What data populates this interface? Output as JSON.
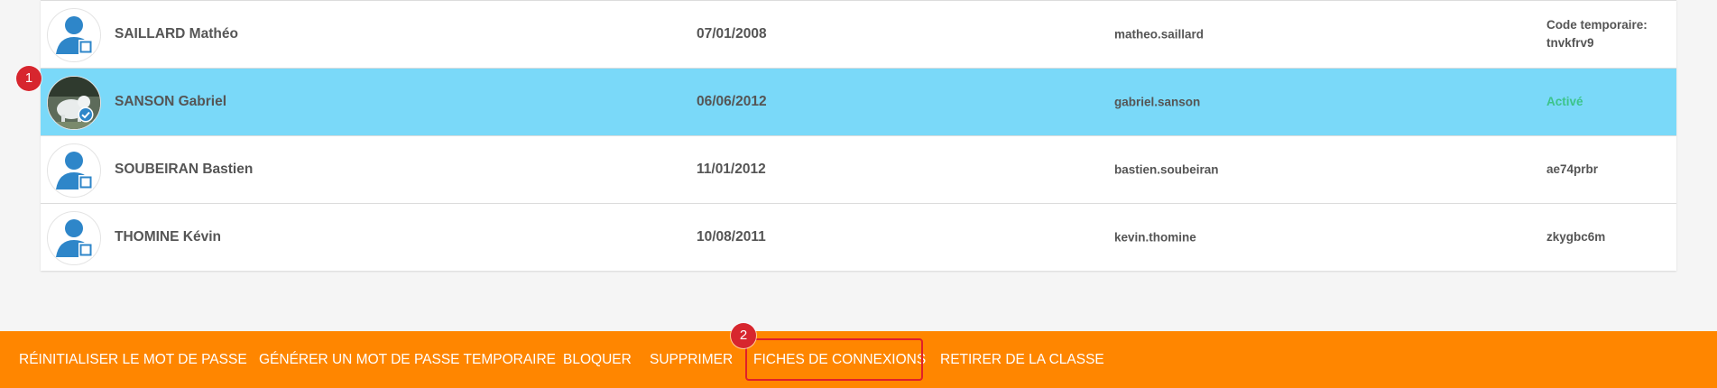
{
  "students": [
    {
      "name": "SAILLARD Mathéo",
      "dob": "07/01/2008",
      "login": "matheo.saillard",
      "status_line1": "Code temporaire:",
      "status_line2": "tnvkfrv9",
      "avatar": "default-user-icon",
      "selected": false
    },
    {
      "name": "SANSON Gabriel",
      "dob": "06/06/2012",
      "login": "gabriel.sanson",
      "status_line1": "Activé",
      "status_line2": "",
      "avatar": "photo-avatar",
      "selected": true
    },
    {
      "name": "SOUBEIRAN Bastien",
      "dob": "11/01/2012",
      "login": "bastien.soubeiran",
      "status_line1": "ae74prbr",
      "status_line2": "",
      "avatar": "default-user-icon",
      "selected": false
    },
    {
      "name": "THOMINE Kévin",
      "dob": "10/08/2011",
      "login": "kevin.thomine",
      "status_line1": "zkygbc6m",
      "status_line2": "",
      "avatar": "default-user-icon",
      "selected": false
    }
  ],
  "toolbar": {
    "reset_password": "RÉINITIALISER LE MOT DE PASSE",
    "temp_password": "GÉNÉRER UN MOT DE PASSE TEMPORAIRE",
    "block": "BLOQUER",
    "delete": "SUPPRIMER",
    "login_sheets": "FICHES DE CONNEXIONS",
    "remove_from_class": "RETIRER DE LA CLASSE"
  },
  "annotations": {
    "step1": "1",
    "step2": "2"
  },
  "colors": {
    "selected_row": "#7ad9f9",
    "toolbar": "#ff8600",
    "active_status": "#3cc48a",
    "annotation": "#d7262e",
    "avatar_blue": "#2e86c9"
  }
}
